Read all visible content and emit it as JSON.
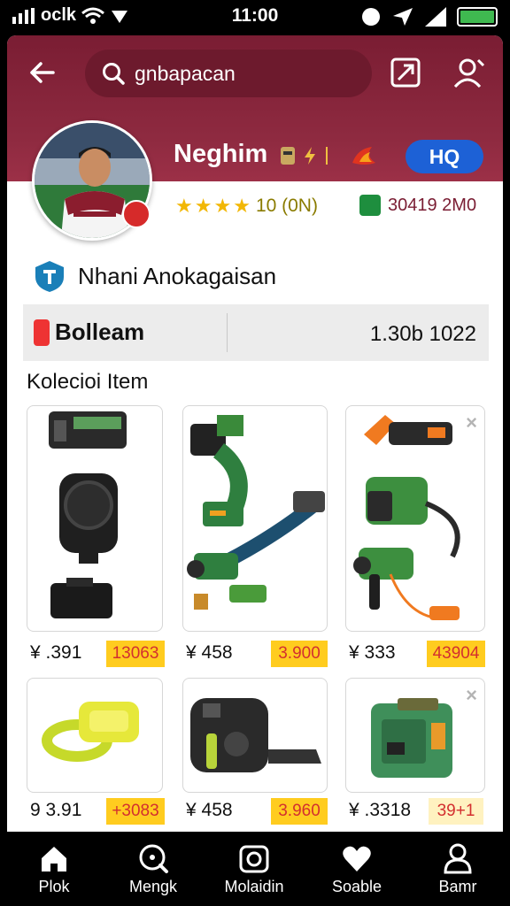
{
  "status_bar": {
    "carrier": "oclk",
    "time": "11:00"
  },
  "header": {
    "search_text": "gnbapacan"
  },
  "profile": {
    "name": "Neghim",
    "badge_label": "HQ",
    "rating_text": "10 (0N)",
    "sales_text": "30419 2M0",
    "shop_name": "Nhani Anokagaisan"
  },
  "info_bar": {
    "brand": "Bolleam",
    "value": "1.30b 1022"
  },
  "section_title": "Kolecioi Item",
  "products": [
    {
      "price": "¥ .391",
      "tag": "13063",
      "name": "battery-drill-set"
    },
    {
      "price": "¥ 458",
      "tag": "3.900",
      "name": "green-cable-tool"
    },
    {
      "price": "¥ 333",
      "tag": "43904",
      "name": "green-heat-gun"
    },
    {
      "price": "9 3.91",
      "tag": "+3083",
      "name": "yellow-strap"
    },
    {
      "price": "¥ 458",
      "tag": "3.960",
      "name": "black-controller"
    },
    {
      "price": "¥ .3318",
      "tag": "39+1",
      "name": "green-box"
    }
  ],
  "bottom_nav": [
    {
      "label": "Plok",
      "icon": "home-icon"
    },
    {
      "label": "Mengk",
      "icon": "search-icon"
    },
    {
      "label": "Molaidin",
      "icon": "camera-icon"
    },
    {
      "label": "Soable",
      "icon": "heart-icon"
    },
    {
      "label": "Bamr",
      "icon": "person-icon"
    }
  ],
  "colors": {
    "header": "#8e2a40",
    "accent_blue": "#1d61d6",
    "price_tag": "#ffcc1f",
    "tag_text": "#d32f2f"
  }
}
